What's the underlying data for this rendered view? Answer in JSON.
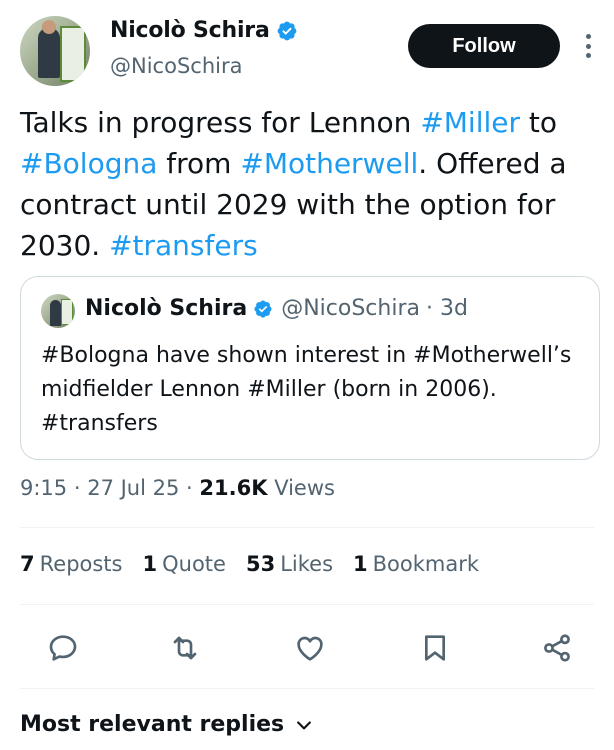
{
  "author": {
    "name": "Nicolò Schira",
    "handle": "@NicoSchira"
  },
  "follow_label": "Follow",
  "tweet": {
    "parts": [
      {
        "text": "Talks in progress for Lennon ",
        "tag": false
      },
      {
        "text": "#Miller",
        "tag": true
      },
      {
        "text": " to ",
        "tag": false
      },
      {
        "text": "#Bologna",
        "tag": true
      },
      {
        "text": " from ",
        "tag": false
      },
      {
        "text": "#Motherwell",
        "tag": true
      },
      {
        "text": ". Offered a contract until 2029 with the option for 2030. ",
        "tag": false
      },
      {
        "text": "#transfers",
        "tag": true
      }
    ]
  },
  "quote": {
    "name": "Nicolò Schira",
    "handle": "@NicoSchira",
    "age": "· 3d",
    "text": "#Bologna have shown interest in #Motherwell’s midfielder Lennon #Miller (born in 2006). #transfers"
  },
  "meta": {
    "time": "9:15",
    "date": "27 Jul 25",
    "views_count": "21.6K",
    "views_label": "Views"
  },
  "stats": {
    "reposts_count": "7",
    "reposts_label": "Reposts",
    "quotes_count": "1",
    "quotes_label": "Quote",
    "likes_count": "53",
    "likes_label": "Likes",
    "bookmarks_count": "1",
    "bookmarks_label": "Bookmark"
  },
  "replies_sort_label": "Most relevant replies",
  "icons": {
    "verified": "verified-badge-icon",
    "reply": "reply-icon",
    "repost": "repost-icon",
    "like": "like-icon",
    "bookmark": "bookmark-icon",
    "share": "share-icon",
    "more": "more-icon",
    "chevron": "chevron-down-icon"
  },
  "colors": {
    "accent": "#1d9bf0",
    "text": "#0f1419",
    "secondary": "#536471",
    "border": "#cfd9de"
  }
}
